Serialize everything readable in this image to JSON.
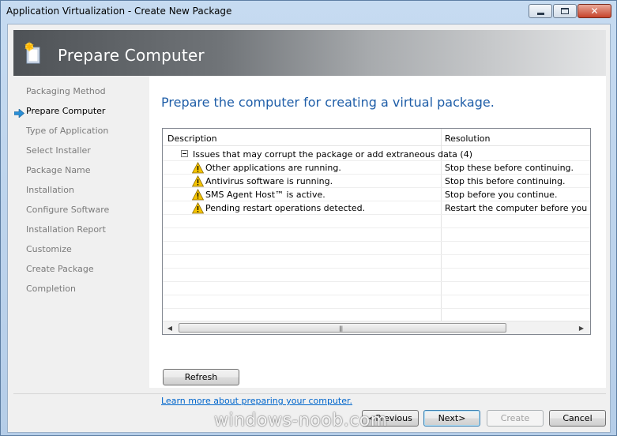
{
  "window": {
    "title": "Application Virtualization - Create New Package"
  },
  "banner": {
    "title": "Prepare Computer",
    "icon": "package-wizard-icon"
  },
  "nav": {
    "items": [
      {
        "label": "Packaging Method",
        "active": false
      },
      {
        "label": "Prepare Computer",
        "active": true
      },
      {
        "label": "Type of Application",
        "active": false
      },
      {
        "label": "Select Installer",
        "active": false
      },
      {
        "label": "Package Name",
        "active": false
      },
      {
        "label": "Installation",
        "active": false
      },
      {
        "label": "Configure Software",
        "active": false
      },
      {
        "label": "Installation Report",
        "active": false
      },
      {
        "label": "Customize",
        "active": false
      },
      {
        "label": "Create Package",
        "active": false
      },
      {
        "label": "Completion",
        "active": false
      }
    ]
  },
  "main": {
    "heading": "Prepare the computer for creating a virtual package.",
    "grid": {
      "columns": [
        "Description",
        "Resolution"
      ],
      "group": "Issues that may corrupt the package or add extraneous data (4)",
      "rows": [
        {
          "description": "Other applications are running.",
          "resolution": "Stop these before continuing."
        },
        {
          "description": "Antivirus software is running.",
          "resolution": "Stop this before continuing."
        },
        {
          "description": "SMS Agent Host™  is active.",
          "resolution": "Stop before you continue."
        },
        {
          "description": "Pending restart operations detected.",
          "resolution": "Restart the computer before you sequ"
        }
      ]
    },
    "refresh_label": "Refresh",
    "learn_more_link": "Learn more about preparing your computer."
  },
  "footer": {
    "previous_label": "<Previous",
    "next_label": "Next>",
    "create_label": "Create",
    "cancel_label": "Cancel"
  },
  "watermark": "windows-noob.com",
  "colors": {
    "heading": "#1f5ea8",
    "link": "#0066cc",
    "nav_inactive": "#7a7a7a",
    "warning": "#f5c400"
  }
}
